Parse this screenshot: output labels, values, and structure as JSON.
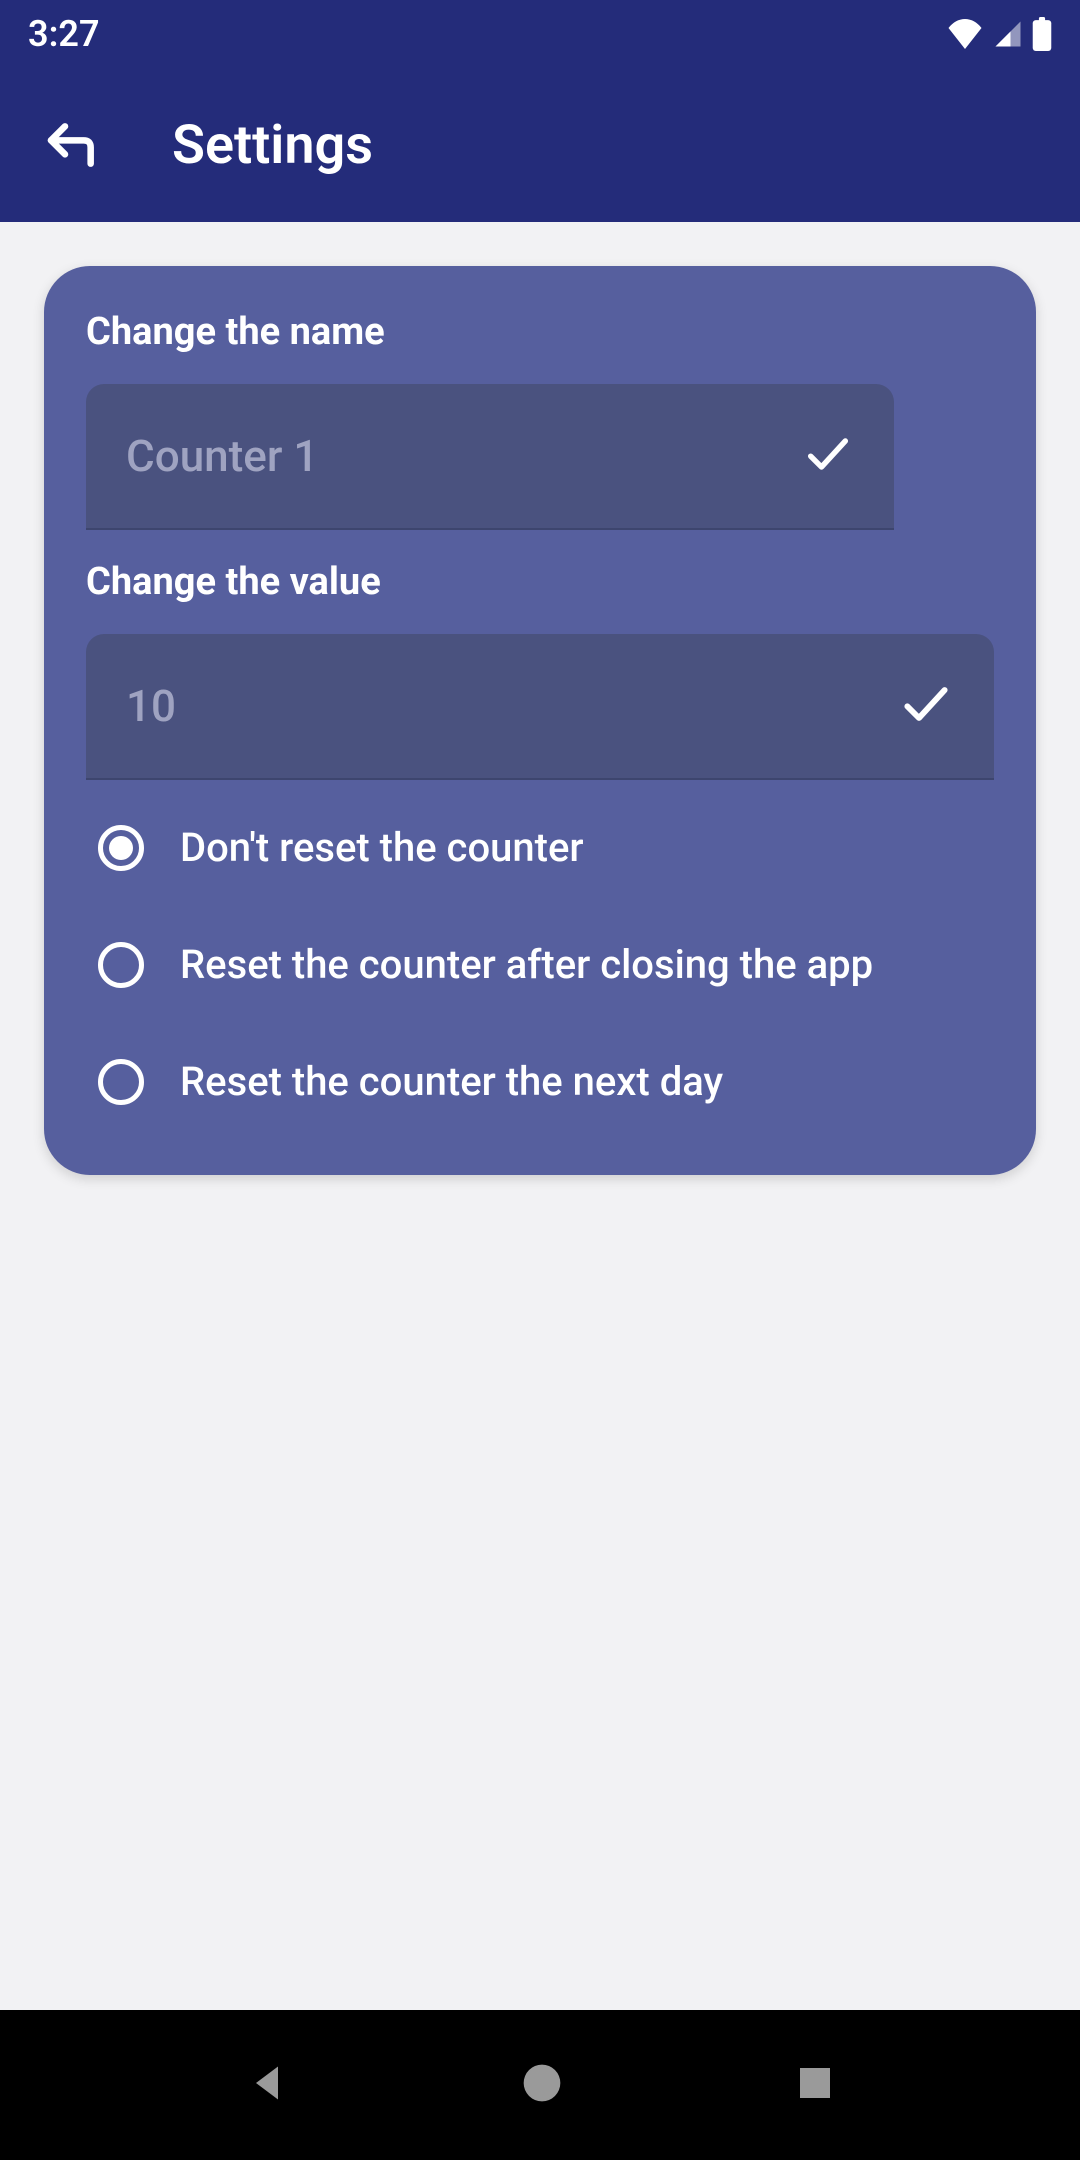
{
  "status": {
    "time": "3:27"
  },
  "header": {
    "title": "Settings"
  },
  "card": {
    "name_label": "Change the name",
    "name_value": "Counter 1",
    "value_label": "Change the value",
    "value_value": "10",
    "radio_options": [
      {
        "label": "Don't reset the counter",
        "selected": true
      },
      {
        "label": "Reset the counter after closing the app",
        "selected": false
      },
      {
        "label": "Reset the counter the next day",
        "selected": false
      }
    ]
  }
}
